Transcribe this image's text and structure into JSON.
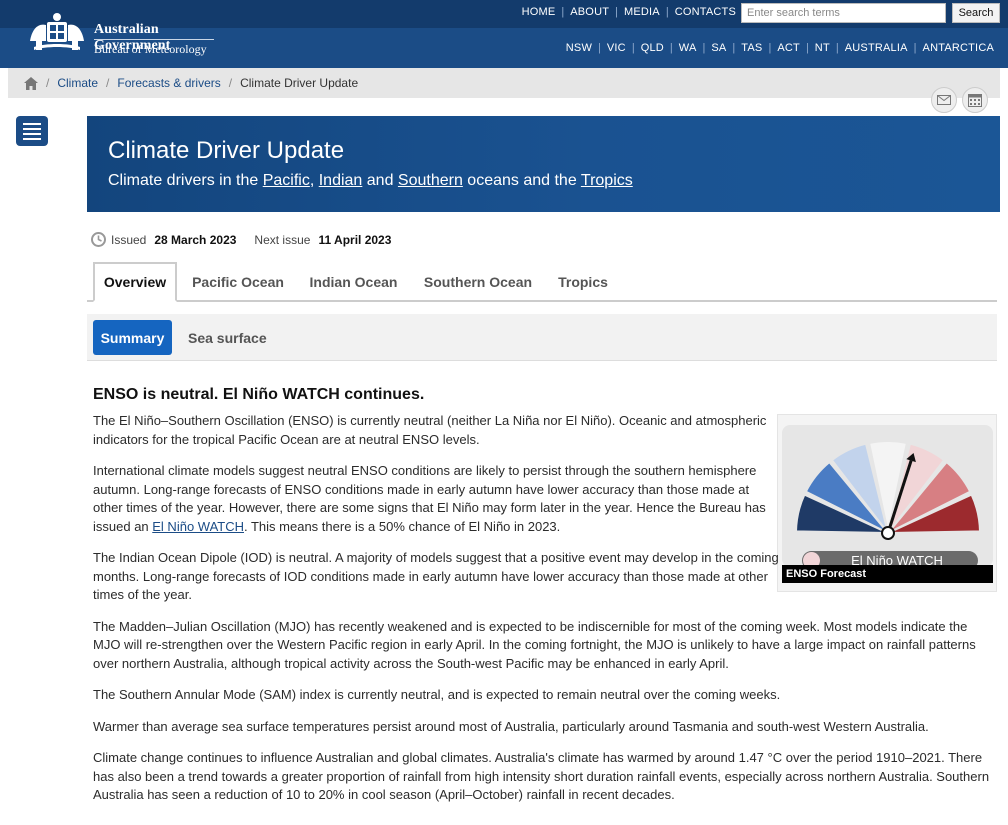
{
  "header": {
    "gov_name": "Australian Government",
    "bureau_name": "Bureau of Meteorology",
    "top_links": [
      "HOME",
      "ABOUT",
      "MEDIA",
      "CONTACTS"
    ],
    "search_placeholder": "Enter search terms",
    "search_button": "Search",
    "state_links": [
      "NSW",
      "VIC",
      "QLD",
      "WA",
      "SA",
      "TAS",
      "ACT",
      "NT",
      "AUSTRALIA",
      "ANTARCTICA"
    ]
  },
  "breadcrumb": {
    "items": [
      "Climate",
      "Forecasts & drivers"
    ],
    "current": "Climate Driver Update"
  },
  "banner": {
    "title": "Climate Driver Update",
    "subtitle_prefix": "Climate drivers in the ",
    "pacific": "Pacific",
    "indian": "Indian",
    "and": " and ",
    "southern": "Southern",
    "oceans_and_the": " oceans and the ",
    "tropics": "Tropics"
  },
  "issued": {
    "issued_label": "Issued",
    "issued_date": "28 March 2023",
    "next_label": "Next issue",
    "next_date": "11 April 2023"
  },
  "tabs": [
    "Overview",
    "Pacific Ocean",
    "Indian Ocean",
    "Southern Ocean",
    "Tropics"
  ],
  "subtabs": {
    "active": "Summary",
    "other": "Sea surface"
  },
  "content": {
    "heading": "ENSO is neutral. El Niño WATCH continues.",
    "p1": "The El Niño–Southern Oscillation (ENSO) is currently neutral (neither La Niña nor El Niño). Oceanic and atmospheric indicators for the tropical Pacific Ocean are at neutral ENSO levels.",
    "p2_before": "International climate models suggest neutral ENSO conditions are likely to persist through the southern hemisphere autumn. Long-range forecasts of ENSO conditions made in early autumn have lower accuracy than those made at other times of the year. However, there are some signs that El Niño may form later in the year. Hence the Bureau has issued an ",
    "p2_link": "El Niño WATCH",
    "p2_after": ". This means there is a 50% chance of El Niño in 2023.",
    "p3": "The Indian Ocean Dipole (IOD) is neutral. A majority of models suggest that a positive event may develop in the coming months. Long-range forecasts of IOD conditions made in early autumn have lower accuracy than those made at other times of the year.",
    "p4": "The Madden–Julian Oscillation (MJO) has recently weakened and is expected to be indiscernible for most of the coming week. Most models indicate the MJO will re-strengthen over the Western Pacific region in early April. In the coming fortnight, the MJO is unlikely to have a large impact on rainfall patterns over northern Australia, although tropical activity across the South-west Pacific may be enhanced in early April.",
    "p5": "The Southern Annular Mode (SAM) index is currently neutral, and is expected to remain neutral over the coming weeks.",
    "p6": "Warmer than average sea surface temperatures persist around most of Australia, particularly around Tasmania and south-west Western Australia.",
    "p7": "Climate change continues to influence Australian and global climates. Australia's climate has warmed by around 1.47 °C over the period 1910–2021. There has also been a trend towards a greater proportion of rainfall from high intensity short duration rainfall events, especially across northern Australia. Southern Australia has seen a reduction of 10 to 20% in cool season (April–October) rainfall in recent decades."
  },
  "enso_widget": {
    "status": "El Niño WATCH",
    "caption": "ENSO Forecast",
    "colors": [
      "#1f3a66",
      "#4a7cc4",
      "#c2d3ec",
      "#f4f4f4",
      "#f1d5d7",
      "#d77f83",
      "#9c2a2e"
    ]
  },
  "icons": [
    "home-icon",
    "clock-icon",
    "mail-icon",
    "calendar-icon",
    "menu-icon",
    "crest-icon"
  ]
}
